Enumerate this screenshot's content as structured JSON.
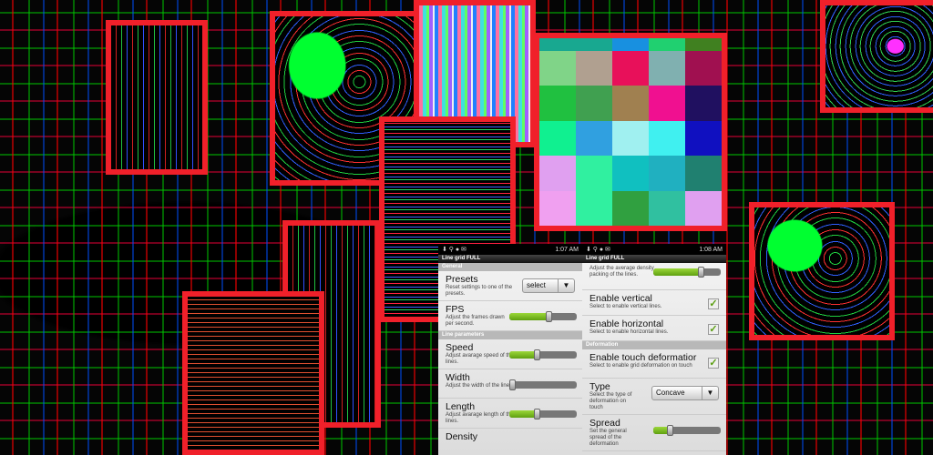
{
  "grid_colors": [
    [
      "#18a890",
      "#18a890",
      "#1890e0",
      "#20d070",
      "#408020"
    ],
    [
      "#80d488",
      "#b0a090",
      "#e8105a",
      "#80b0b0",
      "#a01050"
    ],
    [
      "#20c040",
      "#40a050",
      "#a08050",
      "#f01090",
      "#201060"
    ],
    [
      "#10f090",
      "#30a0e0",
      "#a0f0f0",
      "#40f0f0",
      "#1010c0"
    ],
    [
      "#e0a0f0",
      "#30f0a0",
      "#10c0c0",
      "#20b0c0",
      "#208070"
    ],
    [
      "#f0a0f0",
      "#30f0a0",
      "#30a040",
      "#30c0a0",
      "#e0a0f0"
    ]
  ],
  "phone1": {
    "time": "1:07 AM",
    "app_title": "Line grid FULL",
    "section_general": "General",
    "section_line": "Line parameters",
    "presets": {
      "title": "Presets",
      "summary": "Reset settings to one of the presets.",
      "value": "select"
    },
    "fps": {
      "title": "FPS",
      "summary": "Adjust the frames drawn per second.",
      "level": 0.6
    },
    "speed": {
      "title": "Speed",
      "summary": "Adjust avarage speed of the lines.",
      "level": 0.42
    },
    "width": {
      "title": "Width",
      "summary": "Adjust the width of the lines.",
      "level": 0.05
    },
    "length": {
      "title": "Length",
      "summary": "Adjust avarage length of the lines.",
      "level": 0.42
    },
    "density": {
      "title": "Density"
    }
  },
  "phone2": {
    "time": "1:08 AM",
    "app_title": "Line grid FULL",
    "density_summary": "Adjust the average density packing of the lines.",
    "density_level": 0.72,
    "vertical": {
      "title": "Enable vertical",
      "summary": "Select to enable vertical lines.",
      "checked": true
    },
    "horizontal": {
      "title": "Enable horizontal",
      "summary": "Select to enable horizontal lines.",
      "checked": true
    },
    "section_deformation": "Deformation",
    "touch": {
      "title": "Enable touch deformatior",
      "summary": "Select to enable grid deformation on touch",
      "checked": true
    },
    "type": {
      "title": "Type",
      "summary": "Select the type of deformation on touch",
      "value": "Concave"
    },
    "spread": {
      "title": "Spread",
      "summary": "Set the general spread of the deformation",
      "level": 0.25
    }
  }
}
